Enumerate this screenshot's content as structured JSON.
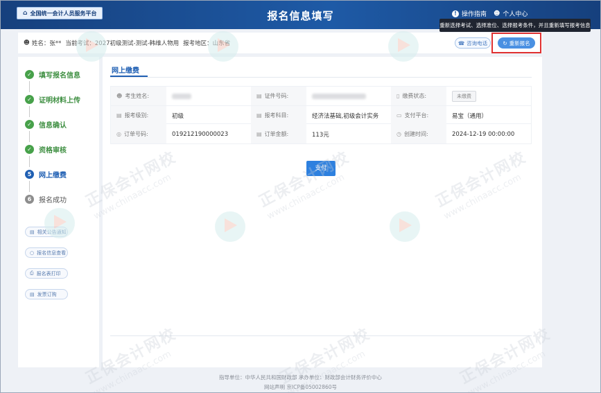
{
  "header": {
    "home_label": "全国统一会计人员服务平台",
    "title": "报名信息填写",
    "guide_label": "操作指南",
    "user_center_label": "个人中心"
  },
  "tooltip": "重新选择考试、选择准位、选择报考条件，并且重新填写报考信息",
  "infobar": {
    "name": "姓名：张**",
    "exam": "当前考试：2027初级测试-测试-韩维人物用",
    "region": "报考地区：山东省",
    "btn_ghost": "咨询电话",
    "btn_reapply": "重新报名"
  },
  "steps": [
    {
      "label": "填写报名信息",
      "status": "done"
    },
    {
      "label": "证明材料上传",
      "status": "done"
    },
    {
      "label": "信息确认",
      "status": "done"
    },
    {
      "label": "资格审核",
      "status": "done"
    },
    {
      "label": "网上缴费",
      "status": "current",
      "num": "5"
    },
    {
      "label": "报名成功",
      "status": "todo",
      "num": "6"
    }
  ],
  "side_buttons": [
    "相关公告通知",
    "报名信息查看",
    "报名表打印",
    "发票订购"
  ],
  "main": {
    "tab": "网上缴费",
    "rows": [
      [
        {
          "key": "考生姓名:",
          "value": ""
        },
        {
          "key": "证件号码:",
          "value": ""
        },
        {
          "key": "缴费状态:",
          "value": "未缴费"
        }
      ],
      [
        {
          "key": "报考级别:",
          "value": "初级"
        },
        {
          "key": "报考科目:",
          "value": "经济法基础,初级会计实务"
        },
        {
          "key": "支付平台:",
          "value": "易宝（通用）"
        }
      ],
      [
        {
          "key": "订单号码:",
          "value": "019212190000023"
        },
        {
          "key": "订单金额:",
          "value": "113元"
        },
        {
          "key": "创建时间:",
          "value": "2024-12-19 00:00:00"
        }
      ]
    ],
    "pay_label": "支付"
  },
  "footer": {
    "line1": "指导单位：中华人民共和国财政部    承办单位：财政部会计财务评价中心",
    "line2": "网站声明    京ICP备05002860号"
  },
  "watermark": {
    "zh": "正保会计网校",
    "en": "www.chinaacc.com"
  }
}
